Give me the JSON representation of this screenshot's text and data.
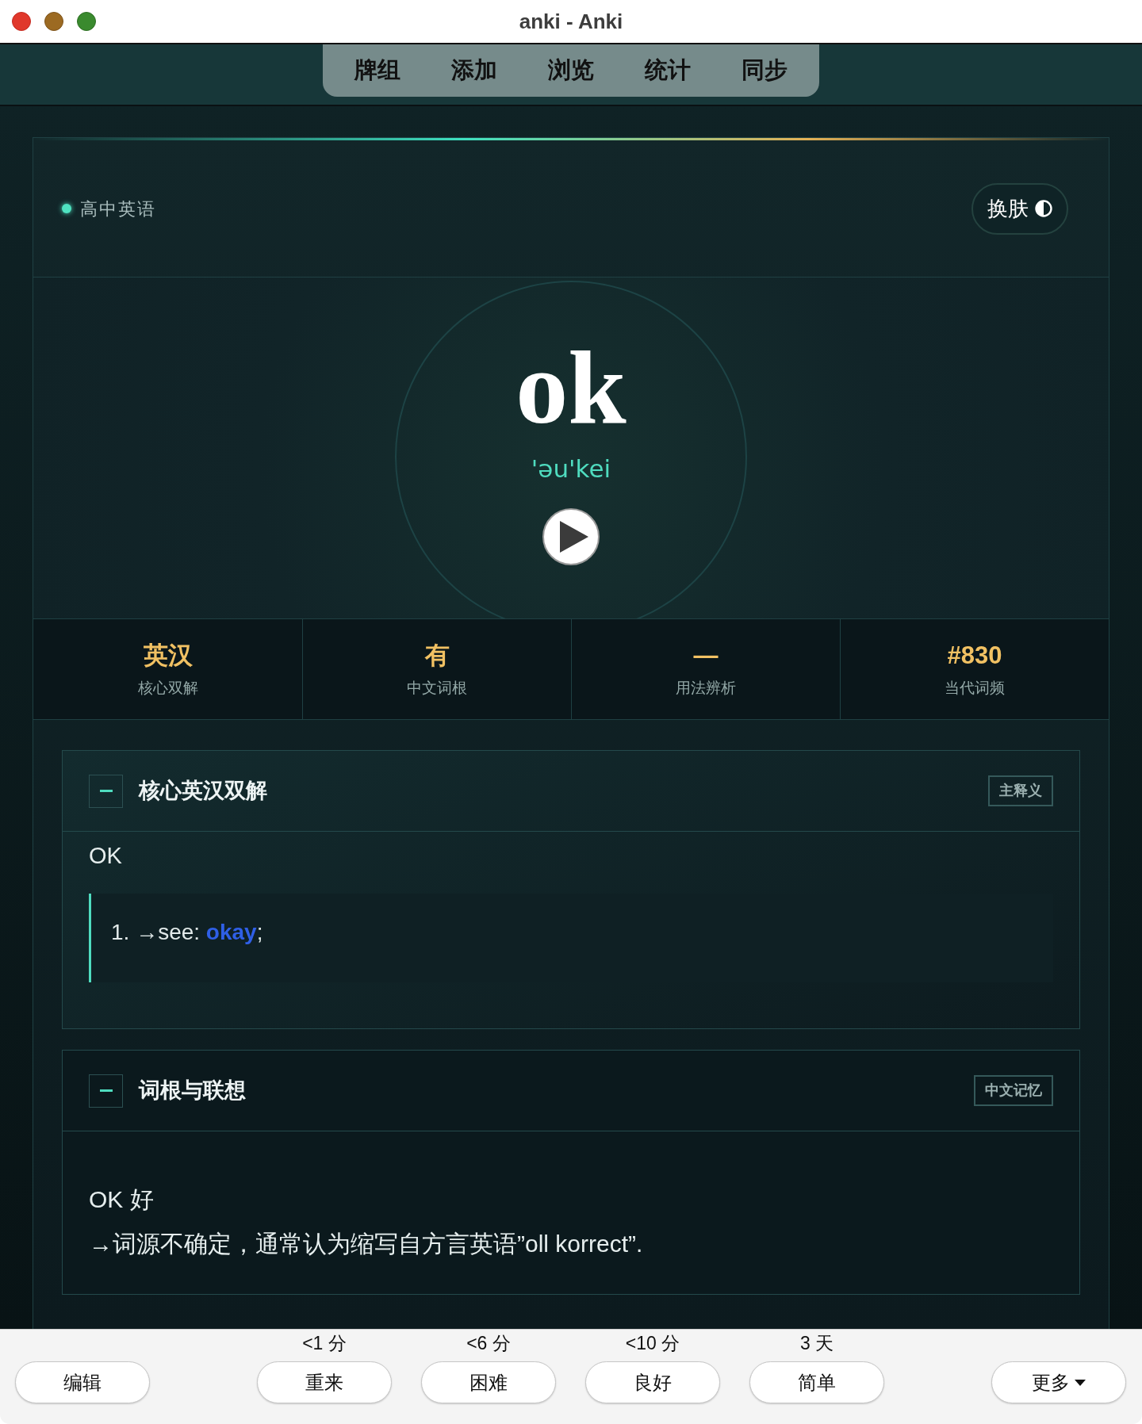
{
  "window": {
    "title": "anki - Anki"
  },
  "toolbar": [
    "牌组",
    "添加",
    "浏览",
    "统计",
    "同步"
  ],
  "card": {
    "deck": "高中英语",
    "skin_button": "换肤",
    "word": "ok",
    "phonetic": "'əu'kei",
    "stats": [
      {
        "value": "英汉",
        "label": "核心双解"
      },
      {
        "value": "有",
        "label": "中文词根"
      },
      {
        "value": "—",
        "label": "用法辨析"
      },
      {
        "value": "#830",
        "label": "当代词频"
      }
    ],
    "sections": [
      {
        "kind": "definitions",
        "title": "核心英汉双解",
        "tag": "主释义",
        "expanded": true,
        "headword": "OK",
        "definitions": [
          {
            "number": "1.",
            "text": "→see:",
            "link": "okay",
            "end": ";"
          }
        ]
      },
      {
        "kind": "notes",
        "title": "词根与联想",
        "tag": "中文记忆",
        "expanded": true,
        "lines": [
          "OK 好",
          "→词源不确定，通常认为缩写自方言英语”oll korrect”."
        ]
      }
    ]
  },
  "bottom_bar": {
    "edit_button": "编辑",
    "answers": [
      {
        "interval": "<1 分",
        "label": "重来"
      },
      {
        "interval": "<6 分",
        "label": "困难"
      },
      {
        "interval": "<10 分",
        "label": "良好"
      },
      {
        "interval": "3 天",
        "label": "简单"
      }
    ],
    "more_button": "更多"
  }
}
